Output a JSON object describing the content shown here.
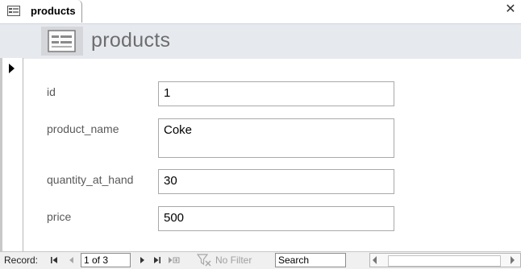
{
  "tab": {
    "label": "products",
    "icon": "form-icon"
  },
  "header": {
    "title": "products",
    "icon": "form-icon"
  },
  "fields": [
    {
      "label": "id",
      "value": "1"
    },
    {
      "label": "product_name",
      "value": "Coke"
    },
    {
      "label": "quantity_at_hand",
      "label_shown": "quantity_at_hanс",
      "value": "30"
    },
    {
      "label": "price",
      "value": "500"
    }
  ],
  "navigation": {
    "record_label": "Record:",
    "record_position": "1 of 3",
    "filter_label": "No Filter",
    "search_text": "Search"
  },
  "colors": {
    "header_band": "#e6e9ee",
    "label_text": "#595959",
    "navbar": "#f0f0f0"
  }
}
